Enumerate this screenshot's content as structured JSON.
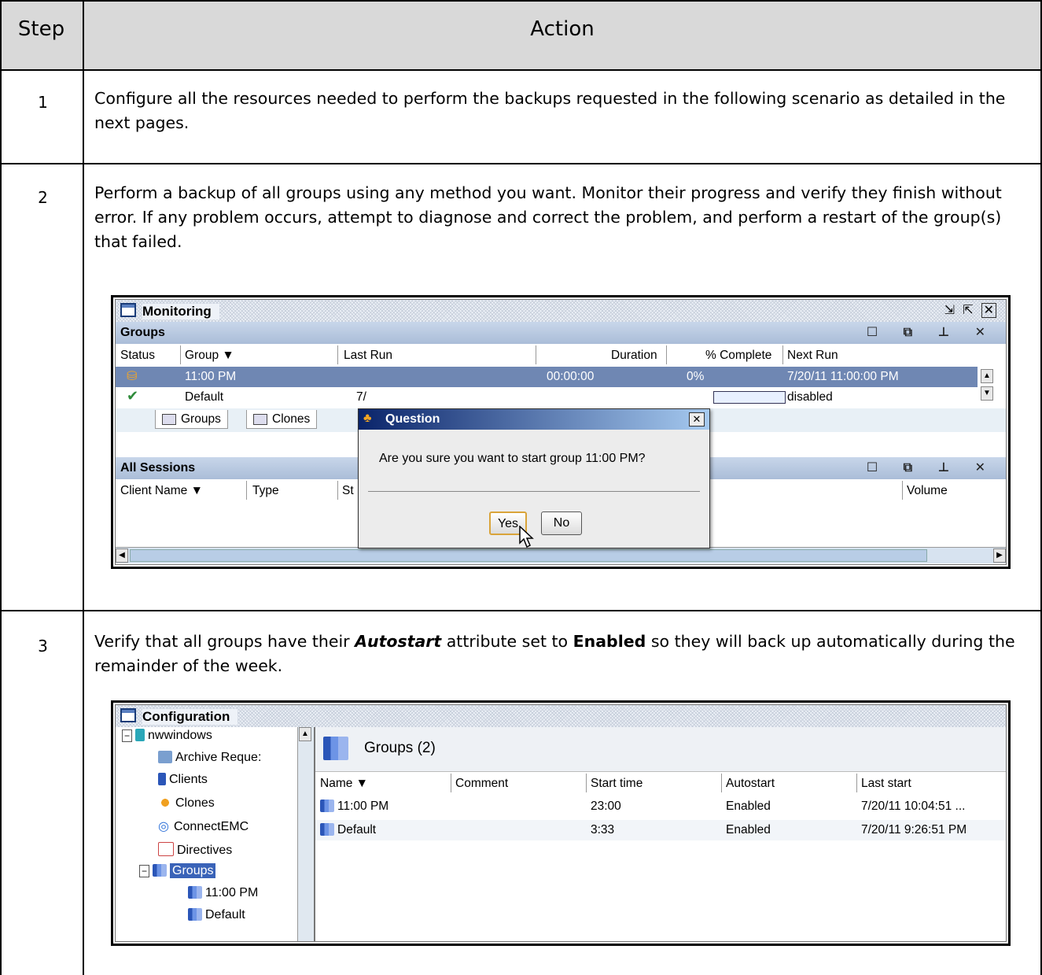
{
  "table": {
    "header": {
      "step": "Step",
      "action": "Action"
    },
    "rows": [
      {
        "step": "1",
        "text": "Configure all the resources needed to perform the backups requested in the following scenario as detailed in the next pages."
      },
      {
        "step": "2",
        "text": "Perform a backup of all groups using any method you want.  Monitor their progress and verify they finish without error.  If any problem occurs, attempt to diagnose and correct the problem, and perform a restart of the group(s) that failed."
      },
      {
        "step": "3",
        "text_pre": "Verify that all groups have their ",
        "text_em": "Autostart",
        "text_mid": " attribute set to ",
        "text_bold": "Enabled",
        "text_post": " so they will back up automatically during the remainder of the week."
      }
    ]
  },
  "monitoring": {
    "title": "Monitoring",
    "groups_section": "Groups",
    "columns": [
      "Status",
      "Group ▼",
      "Last Run",
      "Duration",
      "% Complete",
      "Next Run"
    ],
    "rows": [
      {
        "group": "11:00 PM",
        "duration": "00:00:00",
        "complete": "0%",
        "next_run": "7/20/11 11:00:00 PM"
      },
      {
        "group": "Default",
        "last_run": "7/",
        "next_run": "disabled"
      }
    ],
    "tabs": [
      "Groups",
      "Clones"
    ],
    "sessions_section": "All Sessions",
    "session_columns": [
      "Client Name ▼",
      "Type",
      "St",
      "Volume"
    ],
    "dialog": {
      "title": "Question",
      "message": "Are you sure you want to start group 11:00 PM?",
      "yes": "Yes",
      "no": "No"
    }
  },
  "configuration": {
    "title": "Configuration",
    "tree": [
      "nwwindows",
      "Archive Reque:",
      "Clients",
      "Clones",
      "ConnectEMC",
      "Directives",
      "Groups",
      "11:00 PM",
      "Default"
    ],
    "panel_title": "Groups (2)",
    "columns": [
      "Name ▼",
      "Comment",
      "Start time",
      "Autostart",
      "Last start"
    ],
    "rows": [
      {
        "name": "11:00 PM",
        "comment": "",
        "start": "23:00",
        "autostart": "Enabled",
        "last": "7/20/11 10:04:51 ..."
      },
      {
        "name": "Default",
        "comment": "",
        "start": "3:33",
        "autostart": "Enabled",
        "last": "7/20/11 9:26:51 PM"
      }
    ]
  }
}
